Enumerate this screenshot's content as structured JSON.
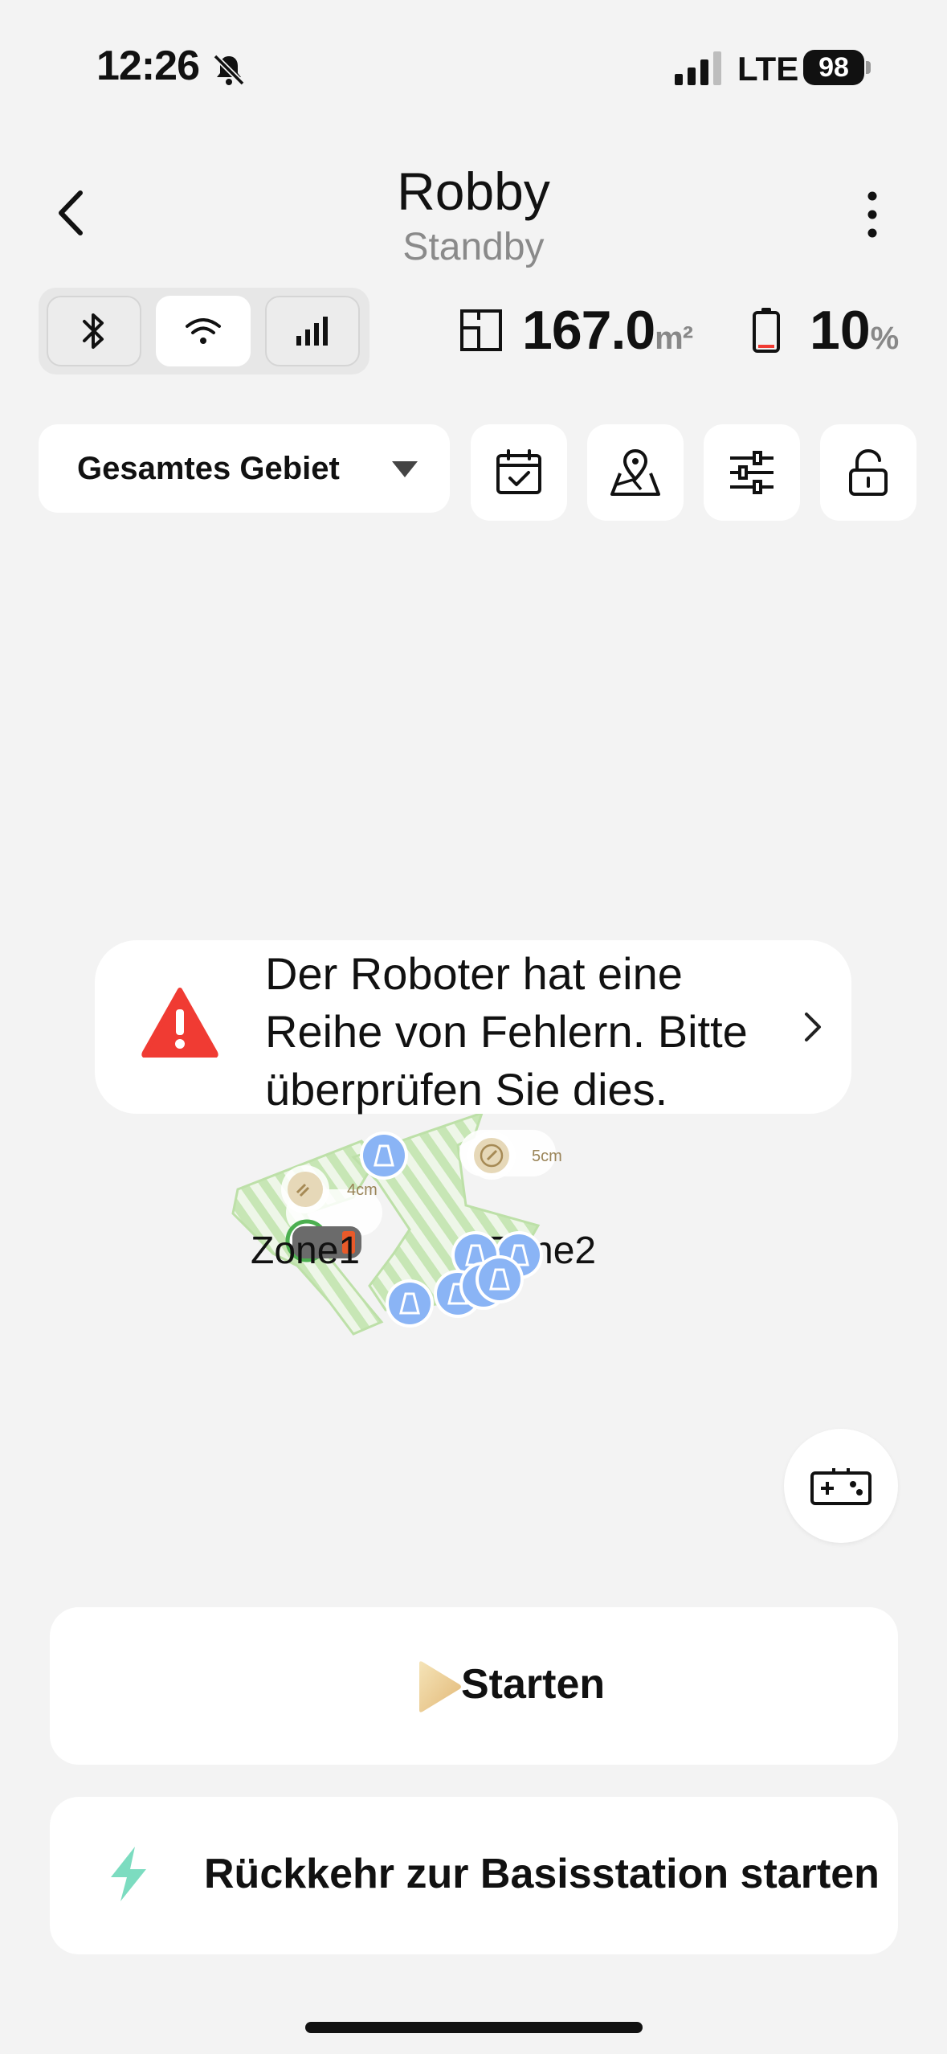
{
  "status_bar": {
    "time": "12:26",
    "network": "LTE",
    "battery": "98",
    "icons": [
      "bell-slash-icon",
      "signal-icon",
      "battery-icon"
    ]
  },
  "header": {
    "title": "Robby",
    "subtitle": "Standby"
  },
  "connectivity": {
    "items": [
      {
        "name": "bluetooth-icon",
        "active": false
      },
      {
        "name": "wifi-icon",
        "active": true
      },
      {
        "name": "cellular-icon",
        "active": false
      }
    ]
  },
  "stats": {
    "area_value": "167.0",
    "area_unit": "m²",
    "battery_value": "10",
    "battery_unit": "%",
    "battery_level": 0.1
  },
  "toolbar": {
    "area_select": "Gesamtes Gebiet",
    "tools": [
      "calendar-check-icon",
      "map-pin-icon",
      "sliders-icon",
      "unlock-icon"
    ]
  },
  "map": {
    "zone1_label": "Zone1",
    "zone2_label": "Zone2",
    "speed_badge": "4cm",
    "height_badge": "5cm"
  },
  "error": {
    "message": "Der Roboter hat eine Reihe von Fehlern. Bitte überprüfen Sie dies."
  },
  "actions": {
    "start_label": "Starten",
    "return_label": "Rückkehr zur Basisstation starten"
  },
  "colors": {
    "accent_red": "#f03b33",
    "accent_green": "#7cdcc0",
    "zone_fill": "#c7e6b5",
    "obstacle_blue": "#8ab4f5"
  }
}
